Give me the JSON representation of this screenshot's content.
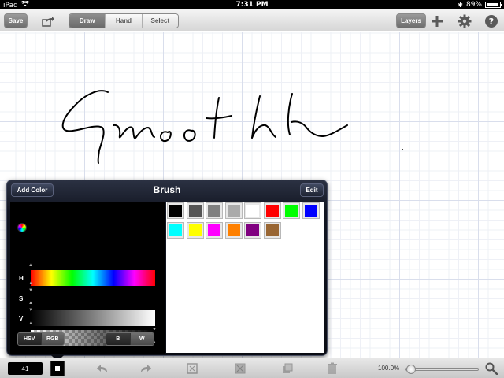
{
  "status_bar": {
    "device": "iPad",
    "time": "7:31 PM",
    "battery_text": "89%",
    "battery_level": 0.89
  },
  "toolbar": {
    "save_label": "Save",
    "modes": [
      "Draw",
      "Hand",
      "Select"
    ],
    "active_mode": "Draw",
    "layers_label": "Layers",
    "icons": [
      "share-icon",
      "plus-icon",
      "gear-icon",
      "help-icon"
    ]
  },
  "canvas": {
    "stroke_color": "#000000",
    "grid_color": "#d9deec"
  },
  "brush_panel": {
    "title": "Brush",
    "add_color_label": "Add Color",
    "edit_label": "Edit",
    "channels": [
      "H",
      "S",
      "V",
      "A"
    ],
    "mode_buttons": [
      "HSV",
      "RGB"
    ],
    "bw_buttons": [
      "B",
      "W"
    ],
    "palette": [
      "#000000",
      "#555555",
      "#808080",
      "#aaaaaa",
      "#ffffff",
      "#ff0000",
      "#00ff00",
      "#0000ff",
      "#00ffff",
      "#ffff00",
      "#ff00ff",
      "#ff8000",
      "#800080",
      "#996633"
    ]
  },
  "bottom_bar": {
    "brush_size": "41",
    "current_color": "#000000",
    "zoom_label": "100.0%",
    "zoom_level": 0.08,
    "icons": [
      "undo-icon",
      "redo-icon",
      "layer-merge-icon",
      "layer-clear-icon",
      "layer-duplicate-icon",
      "trash-icon",
      "magnifier-icon"
    ]
  }
}
